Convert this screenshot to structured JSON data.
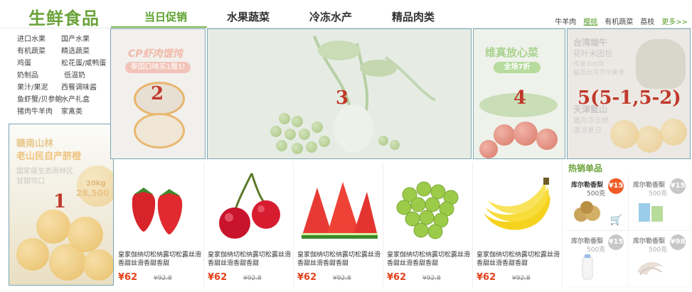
{
  "brand": "生鲜食品",
  "tabs": [
    "当日促销",
    "水果蔬菜",
    "冷冻水产",
    "精品肉类"
  ],
  "hot_tags": [
    "牛羊肉",
    "樱桃",
    "有机蔬菜",
    "荔枝",
    "更多>>"
  ],
  "categories": [
    "进口水果",
    "国产水果",
    "有机蔬菜",
    "精选蔬菜",
    "鸡蛋",
    "松花蛋/咸鸭蛋",
    "奶制品",
    "低温奶",
    "果汁/果泥",
    "西餐调味酱",
    "鱼虾蟹/贝参鲍",
    "水产礼盒",
    "猪肉牛羊肉",
    "家禽类"
  ],
  "banners": {
    "b1": {
      "num": "1",
      "title": "赣南山林",
      "subtitle": "老山民自产脐橙",
      "line1": "国家级生态雨林区",
      "line2": "甘甜可口",
      "weight": "20kg",
      "price": "28,500"
    },
    "b2": {
      "num": "2",
      "title": "CP虾肉馄饨",
      "pill": "泰国口味买1赠1!"
    },
    "b3": {
      "num": "3"
    },
    "b4": {
      "num": "4",
      "title": "维真放心菜",
      "pill": "全场7折"
    },
    "b5": {
      "num": "5(5-1,5-2)",
      "title": "台湾端午",
      "line1": "花叶米团包",
      "line2": "传承300年",
      "line3": "最具台湾节令美食",
      "title2": "天津藍山",
      "line4": "眉月冻云桥",
      "line5": "清凉夏日"
    }
  },
  "products": [
    {
      "name": "皇家伽纳切松纳露切松露丝滑香甜丝滑香甜香甜",
      "price": "¥62",
      "old_price": "¥92.8",
      "icon": "strawberry"
    },
    {
      "name": "皇家伽纳切松纳露切松露丝滑香甜丝滑香甜香甜",
      "price": "¥62",
      "old_price": "¥92.8",
      "icon": "cherry"
    },
    {
      "name": "皇家伽纳切松纳露切松露丝滑香甜丝滑香甜香甜",
      "price": "¥62",
      "old_price": "¥92.8",
      "icon": "watermelon"
    },
    {
      "name": "皇家伽纳切松纳露切松露丝滑香甜丝滑香甜香甜",
      "price": "¥62",
      "old_price": "¥92.8",
      "icon": "grapes"
    },
    {
      "name": "皇家伽纳切松纳露切松露丝滑香甜丝滑香甜香甜",
      "price": "¥62",
      "old_price": "¥92.8",
      "icon": "banana"
    }
  ],
  "hot_title": "热销单品",
  "hot_items": [
    {
      "name": "库尔勒香梨",
      "weight": "500克",
      "badge": "¥15",
      "icon": "pear",
      "badge_color": "#f05a24"
    },
    {
      "name": "库尔勒香梨",
      "weight": "500克",
      "badge": "¥15",
      "icon": "juice-box",
      "badge_color": "#9a9a9a"
    },
    {
      "name": "库尔勒香梨",
      "weight": "500克",
      "badge": "¥15",
      "icon": "milk-bottle",
      "badge_color": "#9a9a9a"
    },
    {
      "name": "库尔勒香梨",
      "weight": "500克",
      "badge": "¥98",
      "icon": "shrimp",
      "badge_color": "#9a9a9a"
    }
  ],
  "colors": {
    "brand_green": "#6aa33a",
    "price_red": "#e4411a",
    "number_red": "#c0392b"
  }
}
